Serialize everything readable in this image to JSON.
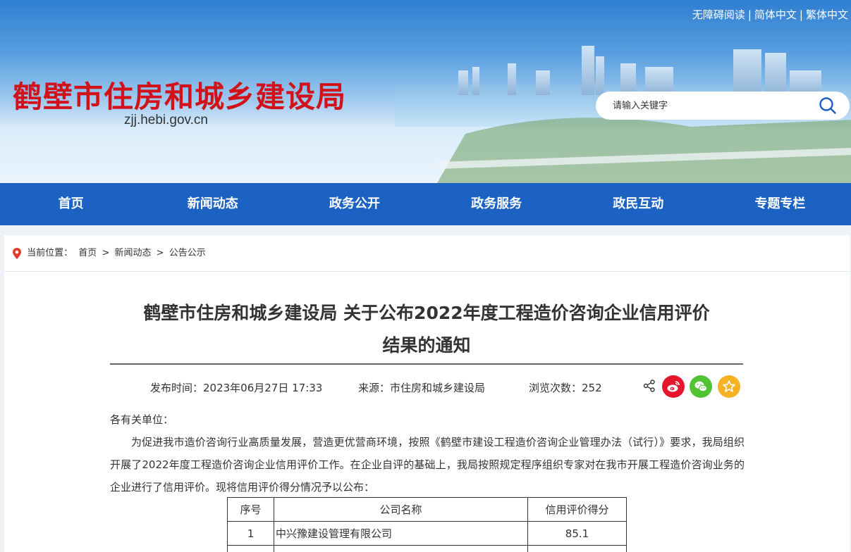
{
  "header": {
    "site_title": "鹤壁市住房和城乡建设局",
    "site_domain": "zjj.hebi.gov.cn",
    "top_links": [
      "无障碍阅读",
      "简体中文",
      "繁体中文"
    ],
    "search_placeholder": "请输入关键字"
  },
  "nav": {
    "items": [
      "首页",
      "新闻动态",
      "政务公开",
      "政务服务",
      "政民互动",
      "专题专栏"
    ]
  },
  "breadcrumb": {
    "label": "当前位置：",
    "path": [
      "首页",
      "新闻动态",
      "公告公示"
    ],
    "separator": ">"
  },
  "article": {
    "title_line1": "鹤壁市住房和城乡建设局 关于公布2022年度工程造价咨询企业信用评价",
    "title_line2": "结果的通知",
    "publish_time": "发布时间：2023年06月27日 17:33",
    "source": "来源：市住房和城乡建设局",
    "views": "浏览次数：252",
    "salutation": "各有关单位：",
    "paragraph": "为促进我市造价咨询行业高质量发展，营造更优营商环境，按照《鹤壁市建设工程造价咨询企业管理办法（试行）》要求，我局组织开展了2022年度工程造价咨询企业信用评价工作。在企业自评的基础上，我局按照规定程序组织专家对在我市开展工程造价咨询业务的企业进行了信用评价。现将信用评价得分情况予以公布："
  },
  "share": {
    "icons": [
      "share-icon",
      "weibo-icon",
      "wechat-icon",
      "favorite-icon"
    ],
    "colors": {
      "weibo": "#e6162d",
      "wechat": "#51c332",
      "favorite": "#f5b324"
    }
  },
  "table": {
    "headers": [
      "序号",
      "公司名称",
      "信用评价得分"
    ],
    "rows": [
      [
        "1",
        "中兴豫建设管理有限公司",
        "85.1"
      ]
    ]
  },
  "colors": {
    "title_red": "#d1121b",
    "nav_blue": "#1b62c2"
  }
}
